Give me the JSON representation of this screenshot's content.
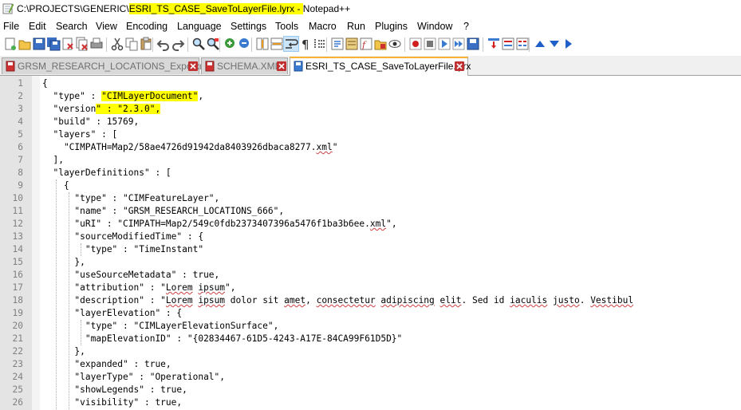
{
  "window": {
    "title_prefix": "C:\\PROJECTS\\GENERIC\\",
    "title_highlight": "ESRI_TS_CASE_SaveToLayerFile.lyrx - ",
    "title_suffix": "Notepad++"
  },
  "menu": [
    "File",
    "Edit",
    "Search",
    "View",
    "Encoding",
    "Language",
    "Settings",
    "Tools",
    "Macro",
    "Run",
    "Plugins",
    "Window",
    "?"
  ],
  "tabs": [
    {
      "label": "GRSM_RESEARCH_LOCATIONS_Expo.xml",
      "active": false
    },
    {
      "label": "SCHEMA.XML",
      "active": false
    },
    {
      "label": "ESRI_TS_CASE_SaveToLayerFile.lyrx",
      "active": true
    }
  ],
  "editor": {
    "line_numbers": [
      "1",
      "2",
      "3",
      "4",
      "5",
      "6",
      "7",
      "8",
      "9",
      "10",
      "11",
      "12",
      "13",
      "14",
      "15",
      "16",
      "17",
      "18",
      "19",
      "20",
      "21",
      "22",
      "23",
      "24",
      "25",
      "26"
    ],
    "lines": [
      "{",
      "  \"type\" : \"CIMLayerDocument\",",
      "  \"version\" : \"2.3.0\",",
      "  \"build\" : 15769,",
      "  \"layers\" : [",
      "    \"CIMPATH=Map2/58ae4726d91942da8403926dbaca8277.xml\"",
      "  ],",
      "  \"layerDefinitions\" : [",
      "    {",
      "      \"type\" : \"CIMFeatureLayer\",",
      "      \"name\" : \"GRSM_RESEARCH_LOCATIONS_666\",",
      "      \"uRI\" : \"CIMPATH=Map2/549c0fdb2373407396a5476f1ba3b6ee.xml\",",
      "      \"sourceModifiedTime\" : {",
      "        \"type\" : \"TimeInstant\"",
      "      },",
      "      \"useSourceMetadata\" : true,",
      "      \"attribution\" : \"Lorem ipsum\",",
      "      \"description\" : \"Lorem ipsum dolor sit amet, consectetur adipiscing elit. Sed id iaculis justo. Vestibul",
      "      \"layerElevation\" : {",
      "        \"type\" : \"CIMLayerElevationSurface\",",
      "        \"mapElevationID\" : \"{02834467-61D5-4243-A17E-84CA99F61D5D}\"",
      "      },",
      "      \"expanded\" : true,",
      "      \"layerType\" : \"Operational\",",
      "      \"showLegends\" : true,",
      "      \"visibility\" : true,"
    ]
  },
  "toolbar_icons": [
    "new-file-icon",
    "open-file-icon",
    "save-icon",
    "save-all-icon",
    "close-icon",
    "close-all-icon",
    "print-icon",
    "cut-icon",
    "copy-icon",
    "paste-icon",
    "undo-icon",
    "redo-icon",
    "find-icon",
    "replace-icon",
    "zoom-in-icon",
    "zoom-out-icon",
    "sync-vertical-icon",
    "sync-horizontal-icon",
    "word-wrap-icon",
    "show-all-chars-icon",
    "indent-guide-icon",
    "language-icon",
    "doc-map-icon",
    "function-list-icon",
    "folder-workspace-icon",
    "monitor-icon",
    "record-macro-icon",
    "stop-record-icon",
    "play-macro-icon",
    "play-multiple-icon",
    "save-macro-icon",
    "insert-column-icon",
    "compare-icon",
    "compare-alt-icon",
    "up-arrow-icon",
    "down-arrow-icon",
    "next-arrow-icon"
  ],
  "colors": {
    "highlight": "#ffff00",
    "active_tab_accent": "#fab330",
    "gutter": "#e4e4e4"
  }
}
